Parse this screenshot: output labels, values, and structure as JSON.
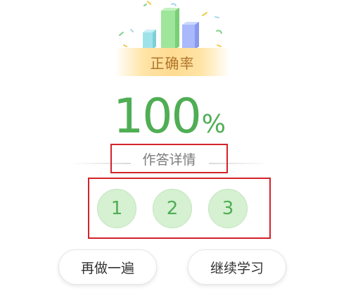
{
  "result": {
    "badge_label": "正确率",
    "score_value": "100",
    "score_unit": "%"
  },
  "details": {
    "title": "作答详情",
    "answers": [
      "1",
      "2",
      "3"
    ]
  },
  "actions": {
    "retry_label": "再做一遍",
    "continue_label": "继续学习"
  },
  "colors": {
    "accent_green": "#4fae54",
    "answer_bg": "#d6f0d2",
    "badge_text": "#b0762a",
    "highlight_border": "#d2232a"
  }
}
